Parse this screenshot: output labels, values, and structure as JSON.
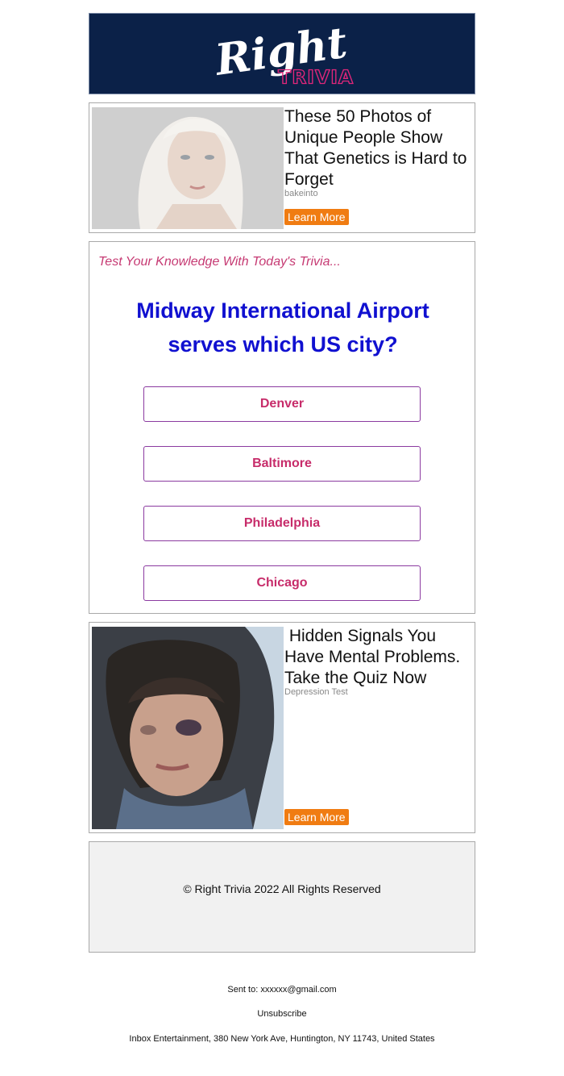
{
  "brand": {
    "logo_script": "Right",
    "logo_sub": "TRIVIA",
    "colors": {
      "header_bg": "#0b2148",
      "sub_accent": "#e0267a",
      "learn_more_bg": "#f07c12",
      "question_color": "#1010d0",
      "answer_color": "#c72c6a",
      "kicker_color": "#c63a73"
    }
  },
  "ads": [
    {
      "title": "These 50 Photos of Unique People Show That Genetics is Hard to Forget",
      "source": "bakeinto",
      "button_label": "Learn More",
      "image_desc": "pale-haired-woman-portrait"
    },
    {
      "title": " Hidden Signals You Have Mental Problems. Take the Quiz Now",
      "source": "Depression Test",
      "button_label": "Learn More",
      "image_desc": "young-man-hoodie-bruised-eye"
    }
  ],
  "quiz": {
    "kicker": "Test Your Knowledge With Today's Trivia...",
    "question": "Midway International Airport serves which US city?",
    "answers": [
      "Denver",
      "Baltimore",
      "Philadelphia",
      "Chicago"
    ]
  },
  "footer": {
    "copyright": "© Right Trivia 2022 All Rights Reserved",
    "sent_to": "Sent to: xxxxxx@gmail.com",
    "unsubscribe": "Unsubscribe",
    "address": "Inbox Entertainment, 380 New York Ave, Huntington, NY 11743, United States"
  }
}
